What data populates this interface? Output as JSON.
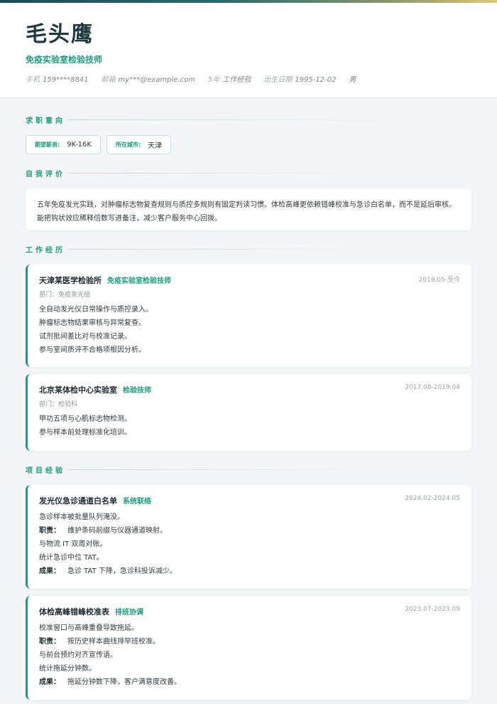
{
  "header": {
    "name": "毛头鹰",
    "title": "免疫实验室检验技师",
    "meta": [
      {
        "label": "手机",
        "value": "159****8841"
      },
      {
        "label": "邮箱",
        "value": "my***@example.com"
      },
      {
        "label": "5年",
        "value": "工作经验"
      },
      {
        "label": "出生日期",
        "value": "1995-12-02"
      },
      {
        "label": "",
        "value": "男"
      }
    ]
  },
  "sections": {
    "intent": "求职意向",
    "summary": "自我评价",
    "work": "工作经历",
    "projects": "项目经验"
  },
  "intent": {
    "salary_label": "期望薪资:",
    "salary": "9K-16K",
    "city_label": "所在城市:",
    "city": "天津"
  },
  "summary": "五年免疫发光实践，对肿瘤标志物复查规则与质控多规则有固定判读习惯。体检高峰更依赖错峰校准与急诊白名单，而不是延后审核。能把钩状效应稀释倍数写进备注，减少客户服务中心回拨。",
  "work": [
    {
      "org": "天津某医学检验所",
      "role": "免疫实验室检验技师",
      "date": "2019.05-至今",
      "dept": "部门：免疫发光组",
      "lines": [
        "全自动发光仪日常操作与质控录入。",
        "肿瘤标志物结果审核与异常复查。",
        "试剂批间差比对与校准记录。",
        "参与室间质评不合格项根因分析。"
      ]
    },
    {
      "org": "北京某体检中心实验室",
      "role": "检验技师",
      "date": "2017.08-2019.04",
      "dept": "部门：检验科",
      "lines": [
        "甲功五项与心肌标志物检测。",
        "参与样本前处理标准化培训。"
      ]
    }
  ],
  "projects": [
    {
      "name": "发光仪急诊通道白名单",
      "role": "系统联络",
      "date": "2024.02-2024.05",
      "background": "急诊样本被批量队列淹没。",
      "duty_label": "职责：",
      "duty": "维护条码前缀与仪器通道映射。",
      "extra": [
        "与物流 IT 双周对账。",
        "统计急诊中位 TAT。"
      ],
      "result_label": "成果：",
      "result": "急诊 TAT 下降，急诊科投诉减少。"
    },
    {
      "name": "体检高峰错峰校准表",
      "role": "排班协调",
      "date": "2023.07-2023.09",
      "background": "校准窗口与高峰重叠导致拖延。",
      "duty_label": "职责：",
      "duty": "按历史样本曲线排早班校准。",
      "extra": [
        "与前台预约对齐宣传语。",
        "统计拖延分钟数。"
      ],
      "result_label": "成果：",
      "result": "拖延分钟数下降，客户满意度改善。"
    }
  ]
}
